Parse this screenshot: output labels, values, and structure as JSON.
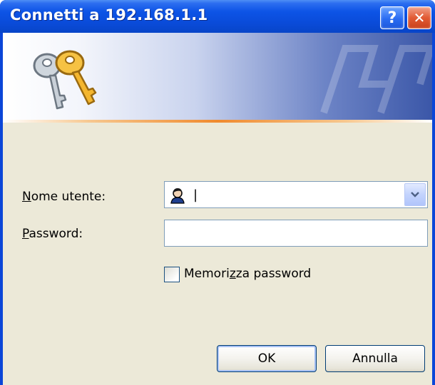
{
  "window": {
    "title": "Connetti a 192.168.1.1",
    "help_glyph": "?",
    "close_glyph": "✕"
  },
  "icons": {
    "banner": "keys-icon",
    "user": "user-icon",
    "dropdown": "chevron-down-icon"
  },
  "form": {
    "username": {
      "label_mnemonic": "N",
      "label_rest": "ome utente:",
      "value": "|"
    },
    "password": {
      "label_mnemonic": "P",
      "label_rest": "assword:",
      "value": ""
    },
    "remember": {
      "label_pre": "Memori",
      "label_mnemonic": "z",
      "label_post": "za password",
      "checked": false
    }
  },
  "buttons": {
    "ok": "OK",
    "cancel": "Annulla"
  },
  "colors": {
    "titlebar": "#0a4bd9",
    "client": "#ece9d8",
    "accent_line": "#f08a2e",
    "close_button": "#e25a34"
  }
}
